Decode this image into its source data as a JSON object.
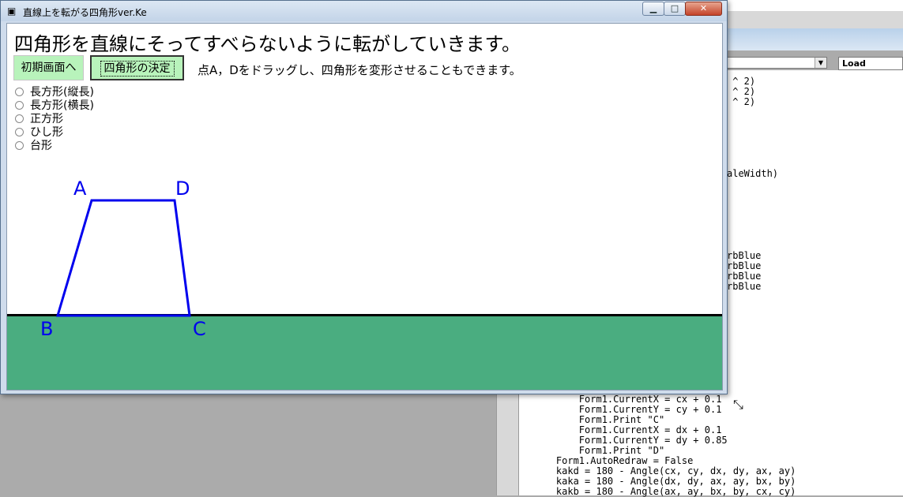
{
  "window": {
    "title": "直線上を転がる四角形ver.Ke",
    "heading": "四角形を直線にそってすべらないように転がしていきます。",
    "reset_button": "初期画面へ",
    "decide_button": "四角形の決定",
    "instruction": "点A，Dをドラッグし、四角形を変形させることもできます。",
    "shape_options": [
      {
        "label": "長方形(縦長)"
      },
      {
        "label": "長方形(横長)"
      },
      {
        "label": "正方形"
      },
      {
        "label": "ひし形"
      },
      {
        "label": "台形"
      }
    ],
    "points": {
      "a": "A",
      "b": "B",
      "c": "C",
      "d": "D"
    },
    "colors": {
      "shape": "#0000ee",
      "ground": "#4aad80",
      "button": "#b8f3bb"
    }
  },
  "ide": {
    "procedure_value": "Load",
    "code_right": [
      " ^ 2)",
      " ^ 2)",
      " ^ 2)",
      "aleWidth)",
      "rbBlue",
      "rbBlue",
      "rbBlue",
      "rbBlue"
    ],
    "code_bottom": [
      "        Form1.CurrentX = cx + 0.1",
      "        Form1.CurrentY = cy + 0.1",
      "        Form1.Print \"C\"",
      "        Form1.CurrentX = dx + 0.1",
      "        Form1.CurrentY = dy + 0.85",
      "        Form1.Print \"D\"",
      "    Form1.AutoRedraw = False",
      "    kakd = 180 - Angle(cx, cy, dx, dy, ax, ay)",
      "    kaka = 180 - Angle(dx, dy, ax, ay, bx, by)",
      "    kakb = 180 - Angle(ax, ay, bx, by, cx, cy)"
    ]
  }
}
